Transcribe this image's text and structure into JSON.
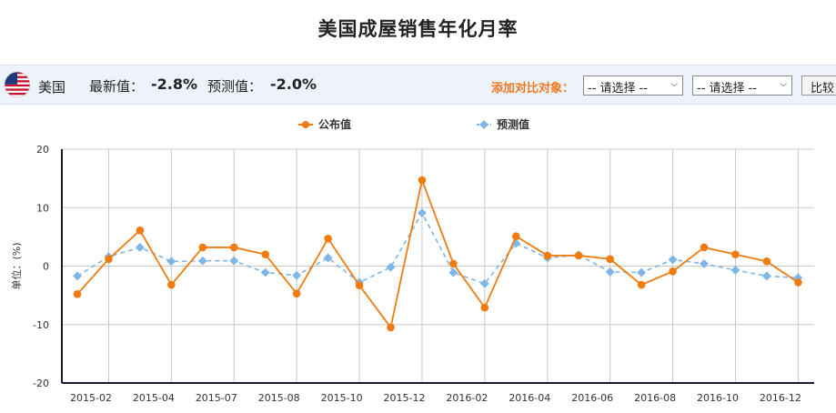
{
  "page": {
    "title": "美国成屋销售年化月率"
  },
  "info": {
    "country": "美国",
    "latest_label": "最新值：",
    "latest_value": "-2.8%",
    "forecast_label": "预测值：",
    "forecast_value": "-2.0%",
    "compare_label": "添加对比对象：",
    "select_1": "-- 请选择 --",
    "select_2": "-- 请选择 --",
    "compare_button": "比较"
  },
  "colors": {
    "published": "#f07c10",
    "forecast": "#7eb6e8",
    "axis": "#1a1a2e",
    "grid": "#c8c8c8"
  },
  "chart_data": {
    "type": "line",
    "title": "",
    "ylabel": "单位：(%)",
    "ylim": [
      -20,
      20
    ],
    "yticks": [
      -20,
      -10,
      0,
      10,
      20
    ],
    "x_tick_labels": [
      {
        "label": "2015-02",
        "x": 0
      },
      {
        "label": "2015-04",
        "x": 2
      },
      {
        "label": "2015-07",
        "x": 4
      },
      {
        "label": "2015-08",
        "x": 6
      },
      {
        "label": "2015-10",
        "x": 8
      },
      {
        "label": "2015-12",
        "x": 10
      },
      {
        "label": "2016-02",
        "x": 12
      },
      {
        "label": "2016-04",
        "x": 14
      },
      {
        "label": "2016-06",
        "x": 16
      },
      {
        "label": "2016-08",
        "x": 18
      },
      {
        "label": "2016-10",
        "x": 20
      },
      {
        "label": "2016-12",
        "x": 22
      }
    ],
    "series": [
      {
        "name": "公布值",
        "style": "solid",
        "values": [
          -4.8,
          1.2,
          6.1,
          -3.2,
          3.2,
          3.2,
          2.0,
          -4.7,
          4.7,
          -3.3,
          -10.5,
          14.7,
          0.4,
          -7.1,
          5.1,
          1.8,
          1.8,
          1.2,
          -3.2,
          -0.9,
          3.2,
          2.0,
          0.8,
          -2.8
        ]
      },
      {
        "name": "预测值",
        "style": "dashed",
        "values": [
          -1.7,
          1.6,
          3.2,
          0.8,
          0.9,
          0.9,
          -1.1,
          -1.6,
          1.4,
          -2.8,
          -0.2,
          9.1,
          -1.1,
          -3.0,
          3.9,
          1.4,
          1.9,
          -1.0,
          -1.1,
          1.1,
          0.4,
          -0.7,
          -1.7,
          -2.0
        ]
      }
    ]
  }
}
